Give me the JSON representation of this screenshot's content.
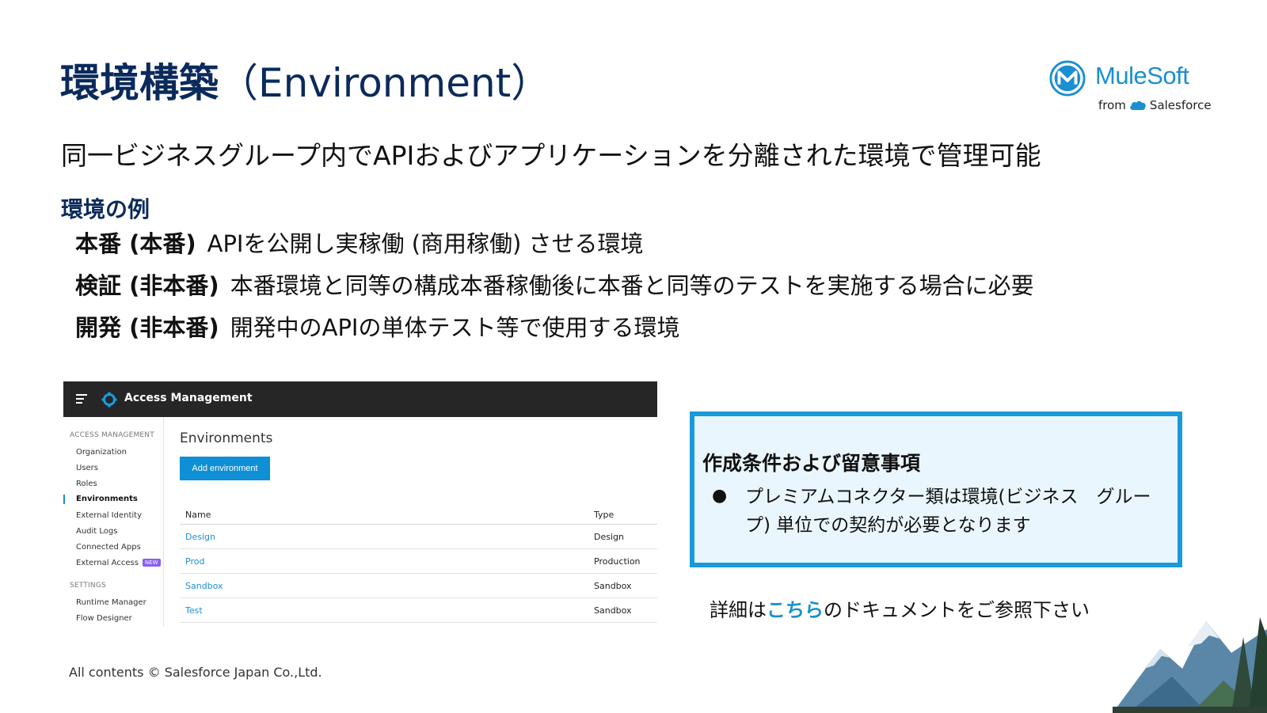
{
  "slide": {
    "title_main": "環境構築",
    "title_sub": "（Environment）",
    "lead": "同一ビジネスグループ内でAPIおよびアプリケーションを分離された環境で管理可能",
    "examples_heading": "環境の例",
    "examples": [
      {
        "label": "本番 (本番)",
        "desc": "APIを公開し実稼働 (商用稼働) させる環境"
      },
      {
        "label": "検証 (非本番)",
        "desc": "本番環境と同等の構成本番稼働後に本番と同等のテストを実施する場合に必要"
      },
      {
        "label": "開発 (非本番)",
        "desc": "開発中のAPIの単体テスト等で使用する環境"
      }
    ],
    "footer": "All contents © Salesforce Japan Co.,Ltd."
  },
  "logo": {
    "brand": "MuleSoft",
    "from": "from",
    "parent": "Salesforce",
    "brand_color": "#1b8fd0"
  },
  "screenshot": {
    "app_title": "Access Management",
    "sections": [
      {
        "heading": "ACCESS MANAGEMENT",
        "items": [
          "Organization",
          "Users",
          "Roles",
          "Environments",
          "External Identity",
          "Audit Logs",
          "Connected Apps",
          "External Access"
        ]
      },
      {
        "heading": "SETTINGS",
        "items": [
          "Runtime Manager",
          "Flow Designer"
        ]
      }
    ],
    "active_item": "Environments",
    "new_badge": "NEW",
    "page_title": "Environments",
    "add_button": "Add environment",
    "columns": [
      "Name",
      "Type"
    ],
    "rows": [
      {
        "name": "Design",
        "type": "Design"
      },
      {
        "name": "Prod",
        "type": "Production"
      },
      {
        "name": "Sandbox",
        "type": "Sandbox"
      },
      {
        "name": "Test",
        "type": "Sandbox"
      }
    ]
  },
  "note": {
    "title": "作成条件および留意事項",
    "bullet_symbol": "●",
    "bullet": "プレミアムコネクター類は環境(ビジネス　グループ) 単位での契約が必要となります"
  },
  "doc_link": {
    "prefix": "詳細は",
    "link": "こちら",
    "suffix": "のドキュメントをご参照下さい"
  },
  "colors": {
    "title": "#0b2a5c",
    "accent": "#1a9ad9",
    "topbar": "#262626",
    "note_bg": "#eaf6fd"
  }
}
